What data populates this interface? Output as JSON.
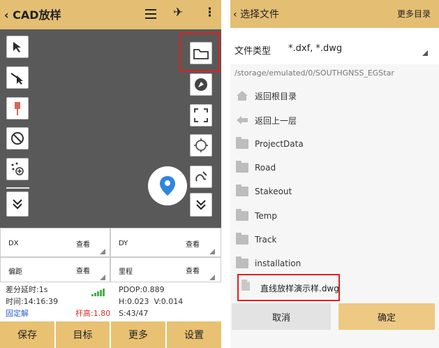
{
  "left": {
    "title": "CAD放样",
    "fields": {
      "dx": {
        "label": "DX",
        "action": "查看"
      },
      "dy": {
        "label": "DY",
        "action": "查看"
      },
      "offset": {
        "label": "偏距",
        "action": "查看"
      },
      "mileage": {
        "label": "里程",
        "action": "查看"
      }
    },
    "status": {
      "diff_delay": "差分延时:1s",
      "time": "时间:14:16:39",
      "fix": "固定解",
      "pole_height": "杆高:1.80",
      "pdop": "PDOP:0.889",
      "hv": "H:0.023  V:0.014",
      "sats": "S:43/47"
    },
    "buttons": [
      "保存",
      "目标",
      "更多",
      "设置"
    ]
  },
  "right": {
    "title": "选择文件",
    "more": "更多目录",
    "file_type_label": "文件类型",
    "file_type_value": "*.dxf, *.dwg",
    "path": "/storage/emulated/0/SOUTHGNSS_EGStar",
    "nav": {
      "root": "返回根目录",
      "up": "返回上一层"
    },
    "folders": [
      "ProjectData",
      "Road",
      "Stakeout",
      "Temp",
      "Track",
      "installation"
    ],
    "file": "直线放样演示样.dwg",
    "cancel": "取消",
    "ok": "确定"
  },
  "colors": {
    "accent": "#e4bf73",
    "button": "#e9c172",
    "pin": "#2f86de",
    "highlight": "#e02020"
  }
}
